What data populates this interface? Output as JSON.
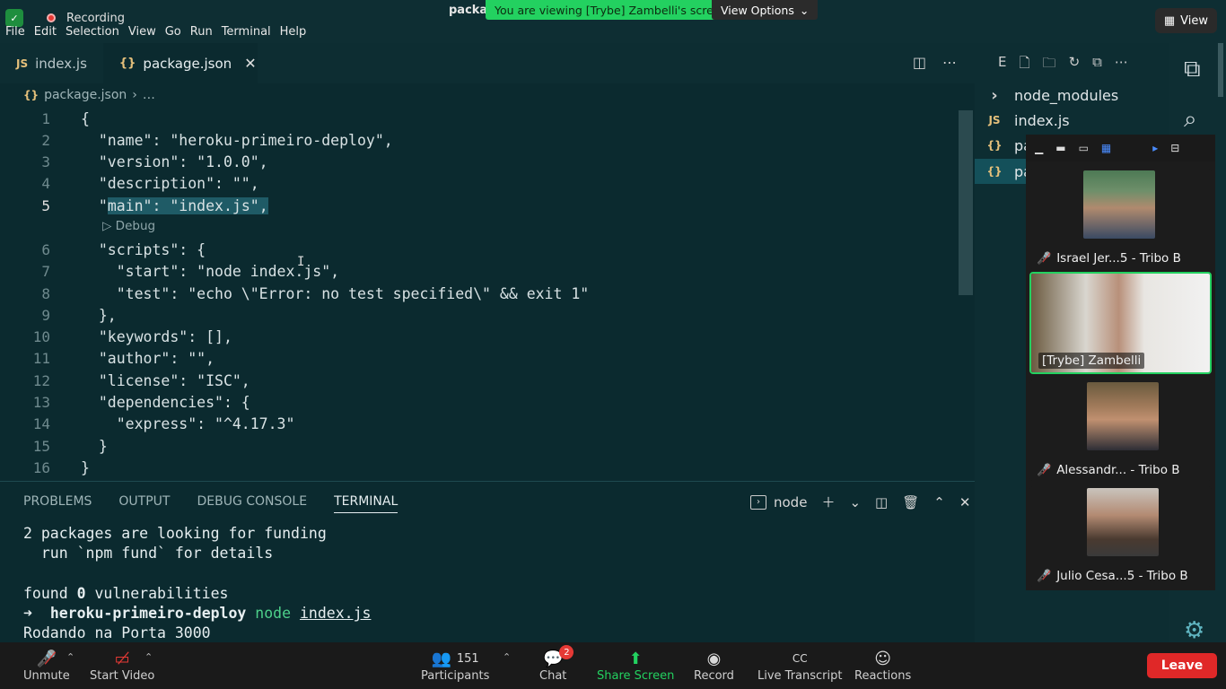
{
  "topbar": {
    "recording_label": "Recording",
    "window_title": "packag",
    "viewing_banner": "You are viewing [Trybe] Zambelli's screen",
    "view_options": "View Options",
    "view_button": "View"
  },
  "menu": [
    "File",
    "Edit",
    "Selection",
    "View",
    "Go",
    "Run",
    "Terminal",
    "Help"
  ],
  "tabs": [
    {
      "icon": "JS",
      "label": "index.js"
    },
    {
      "icon": "{}",
      "label": "package.json"
    }
  ],
  "breadcrumb": {
    "icon": "{}",
    "file": "package.json",
    "more": "…"
  },
  "code": {
    "lines": [
      {
        "n": "1",
        "text": "{"
      },
      {
        "n": "2",
        "text": "  \"name\": \"heroku-primeiro-deploy\","
      },
      {
        "n": "3",
        "text": "  \"version\": \"1.0.0\","
      },
      {
        "n": "4",
        "text": "  \"description\": \"\","
      },
      {
        "n": "5",
        "text": "  \"main\": \"index.js\","
      },
      {
        "n": "6",
        "text": "  \"scripts\": {"
      },
      {
        "n": "7",
        "text": "    \"start\": \"node index.js\","
      },
      {
        "n": "8",
        "text": "    \"test\": \"echo \\\"Error: no test specified\\\" && exit 1\""
      },
      {
        "n": "9",
        "text": "  },"
      },
      {
        "n": "10",
        "text": "  \"keywords\": [],"
      },
      {
        "n": "11",
        "text": "  \"author\": \"\","
      },
      {
        "n": "12",
        "text": "  \"license\": \"ISC\","
      },
      {
        "n": "13",
        "text": "  \"dependencies\": {"
      },
      {
        "n": "14",
        "text": "    \"express\": \"^4.17.3\""
      },
      {
        "n": "15",
        "text": "  }"
      },
      {
        "n": "16",
        "text": "}"
      }
    ],
    "codelens": "▷ Debug"
  },
  "panel": {
    "tabs": [
      "PROBLEMS",
      "OUTPUT",
      "DEBUG CONSOLE",
      "TERMINAL"
    ],
    "terminal_name": "node",
    "terminal": {
      "l1": "2 packages are looking for funding",
      "l2": "  run `npm fund` for details",
      "l3": "",
      "l4a": "found ",
      "l4b": "0",
      "l4c": " vulnerabilities",
      "l5arrow": "➜  ",
      "l5dir": "heroku-primeiro-deploy",
      "l5cmd": " node ",
      "l5arg": "index.js",
      "l6": "Rodando na Porta 3000"
    }
  },
  "explorer": {
    "header_letter": "E",
    "items": [
      {
        "icon": "›",
        "label": "node_modules"
      },
      {
        "icon": "JS",
        "label": "index.js"
      },
      {
        "icon": "{}",
        "label": "pa"
      },
      {
        "icon": "{}",
        "label": "pa"
      }
    ]
  },
  "gallery": {
    "participants": [
      {
        "name": "Israel Jer...5 - Tribo B",
        "muted": true
      },
      {
        "name": "[Trybe] Zambelli",
        "muted": false
      },
      {
        "name": "Alessandr... - Tribo B",
        "muted": true
      },
      {
        "name": "Julio Cesa...5 - Tribo B",
        "muted": true
      }
    ]
  },
  "toolbar": {
    "unmute": "Unmute",
    "start_video": "Start Video",
    "participants": "Participants",
    "participants_count": "151",
    "chat": "Chat",
    "chat_badge": "2",
    "share_screen": "Share Screen",
    "record": "Record",
    "live_transcript": "Live Transcript",
    "reactions": "Reactions",
    "leave": "Leave"
  },
  "colors": {
    "accent_green": "#23d160",
    "leave_red": "#e02828",
    "editor_bg": "#0b2a2f"
  }
}
